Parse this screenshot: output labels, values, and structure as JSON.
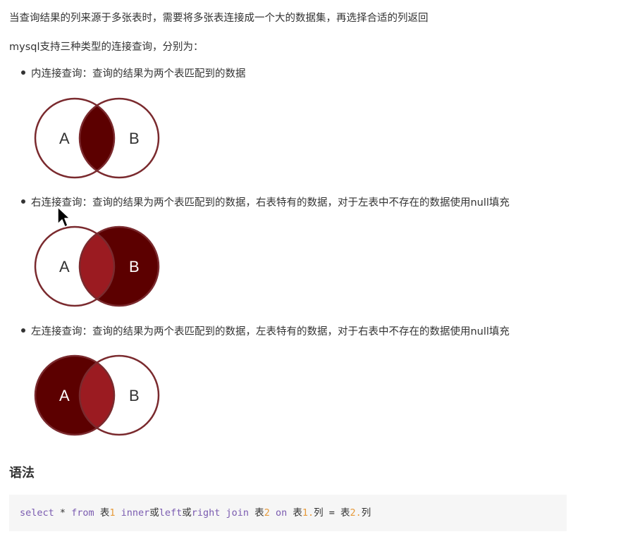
{
  "intro": {
    "line1": "当查询结果的列来源于多张表时，需要将多张表连接成一个大的数据集，再选择合适的列返回",
    "line2": "mysql支持三种类型的连接查询，分别为："
  },
  "join_types": [
    {
      "text": "内连接查询：查询的结果为两个表匹配到的数据",
      "set_a": "A",
      "set_b": "B"
    },
    {
      "text": "右连接查询：查询的结果为两个表匹配到的数据，右表特有的数据，对于左表中不存在的数据使用null填充",
      "set_a": "A",
      "set_b": "B"
    },
    {
      "text": "左连接查询：查询的结果为两个表匹配到的数据，左表特有的数据，对于右表中不存在的数据使用null填充",
      "set_a": "A",
      "set_b": "B"
    }
  ],
  "syntax": {
    "heading": "语法",
    "code": {
      "kw_select": "select",
      "star": " * ",
      "kw_from": "from",
      "table1_word": " 表",
      "table1_num": "1",
      "kw_inner": " inner",
      "or1": "或",
      "kw_left": "left",
      "or2": "或",
      "kw_right": "right",
      "kw_join": " join",
      "table2_word": " 表",
      "table2_num": "2",
      "kw_on": " on",
      "cond_t1": " 表",
      "cond_t1_num": "1.",
      "cond_c1": "列 = 表",
      "cond_t2_num": "2.",
      "cond_c2": "列"
    }
  },
  "colors": {
    "dark_red": "#5c0000",
    "mid_red": "#9b1b21",
    "outline": "#7a2a2e",
    "keyword": "#7a5bb0",
    "number": "#e69a3a"
  },
  "icons": {
    "cursor": "mouse-pointer-icon"
  }
}
